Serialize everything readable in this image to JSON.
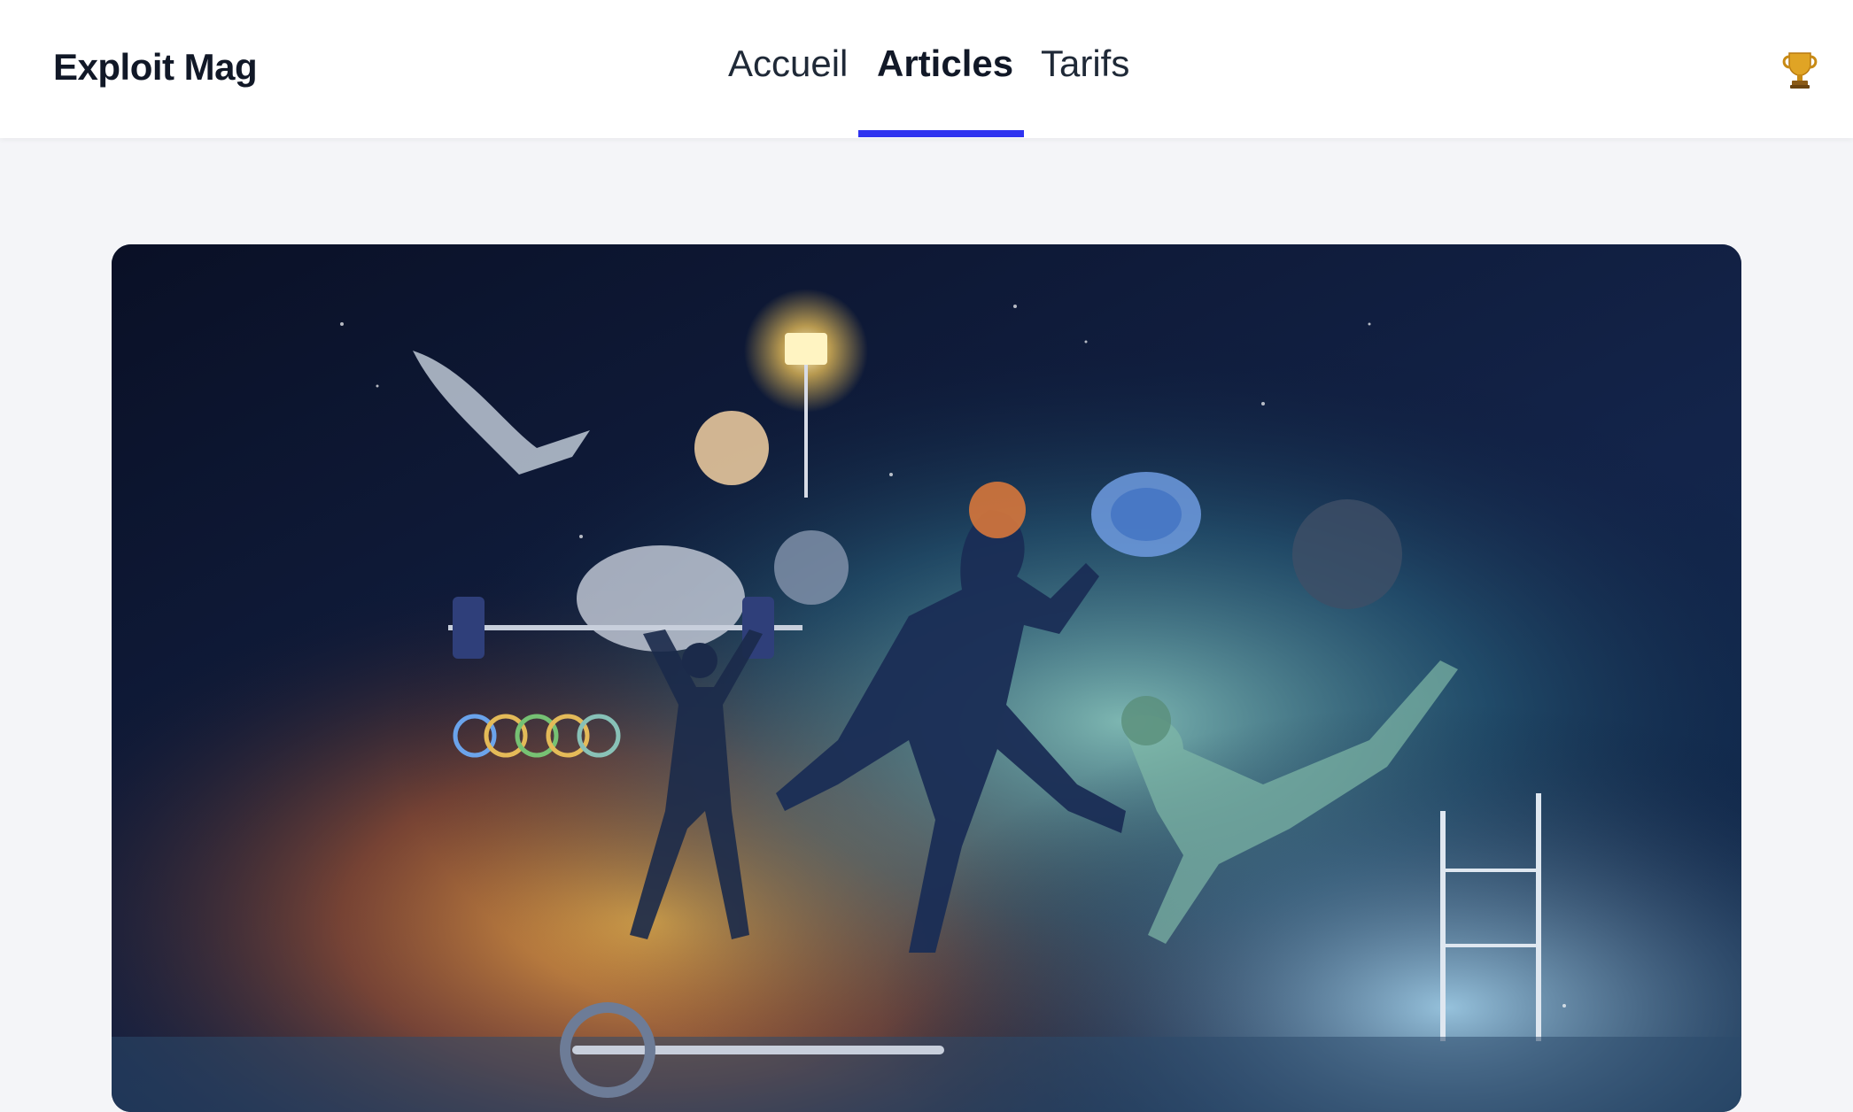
{
  "brand": {
    "name": "Exploit Mag"
  },
  "nav": {
    "items": [
      {
        "label": "Accueil",
        "active": false
      },
      {
        "label": "Articles",
        "active": true
      },
      {
        "label": "Tarifs",
        "active": false
      }
    ]
  },
  "header": {
    "trophy_icon": "trophy-icon"
  },
  "hero": {
    "image": "sports-athletes-illustration"
  },
  "colors": {
    "accent": "#2f33f0",
    "background": "#f4f5f8",
    "text": "#111827"
  }
}
